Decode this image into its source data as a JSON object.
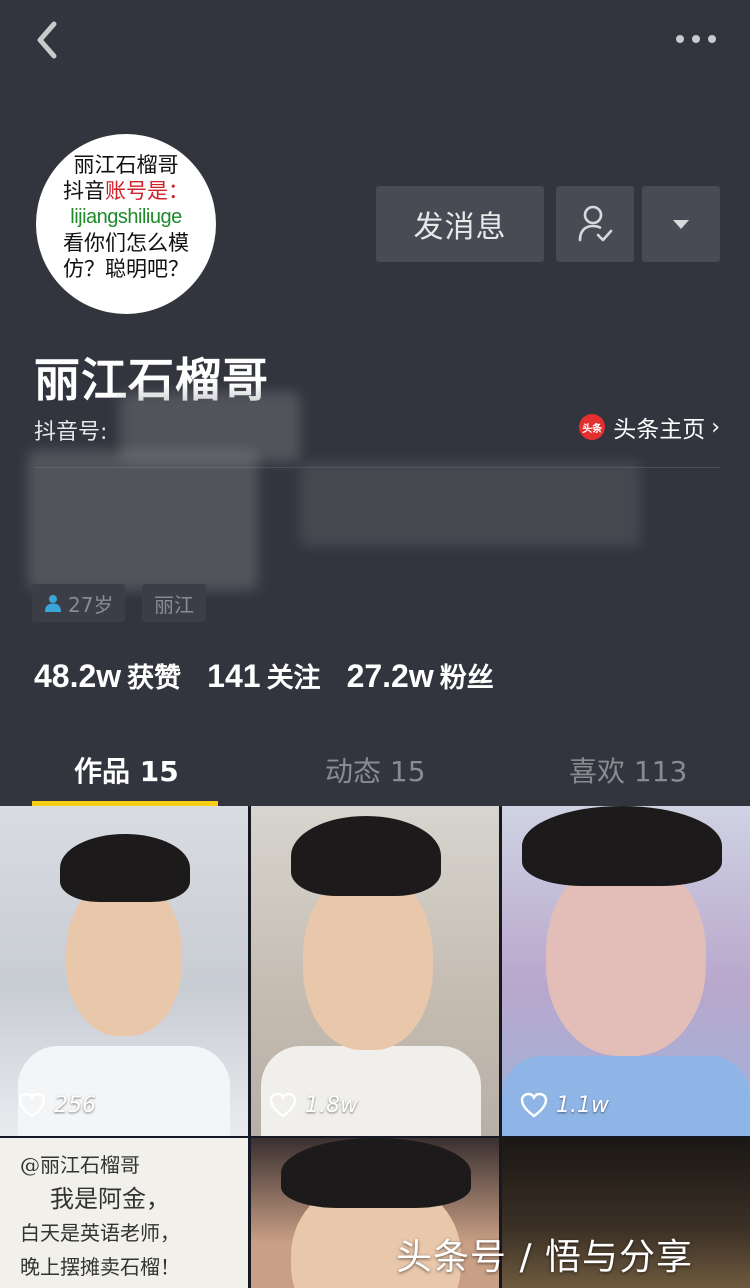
{
  "header": {
    "back_icon": "chevron-left-icon",
    "more_icon": "more-horizontal-icon"
  },
  "profile": {
    "avatar_text": {
      "line1": "丽江石榴哥",
      "line2_prefix": "抖音",
      "line2_red": "账号是：",
      "line3": "lijiangshiliuge",
      "line4": "看你们怎么模",
      "line5": "仿？聪明吧？"
    },
    "name": "丽江石榴哥",
    "id_label": "抖音号:",
    "toutiao_badge": "头条",
    "toutiao_link": "头条主页",
    "tags": {
      "age": "27岁",
      "city": "丽江"
    },
    "stats": [
      {
        "num": "48.2w",
        "label": "获赞"
      },
      {
        "num": "141",
        "label": "关注"
      },
      {
        "num": "27.2w",
        "label": "粉丝"
      }
    ]
  },
  "actions": {
    "message_label": "发消息",
    "follow_icon": "user-check-icon",
    "dropdown_icon": "caret-down-icon"
  },
  "tabs": [
    {
      "label": "作品 15",
      "active": true
    },
    {
      "label": "动态 15",
      "active": false
    },
    {
      "label": "喜欢 113",
      "active": false
    }
  ],
  "videos": [
    {
      "likes": "256"
    },
    {
      "likes": "1.8w"
    },
    {
      "likes": "1.1w"
    }
  ],
  "note_text": {
    "line1": "@丽江石榴哥",
    "line2": "我是阿金，",
    "line3": "白天是英语老师，",
    "line4": "晚上摆摊卖石榴！"
  },
  "watermark": "头条号 / 悟与分享",
  "colors": {
    "background": "#33353e",
    "accent": "#face15",
    "button": "#494b54"
  }
}
